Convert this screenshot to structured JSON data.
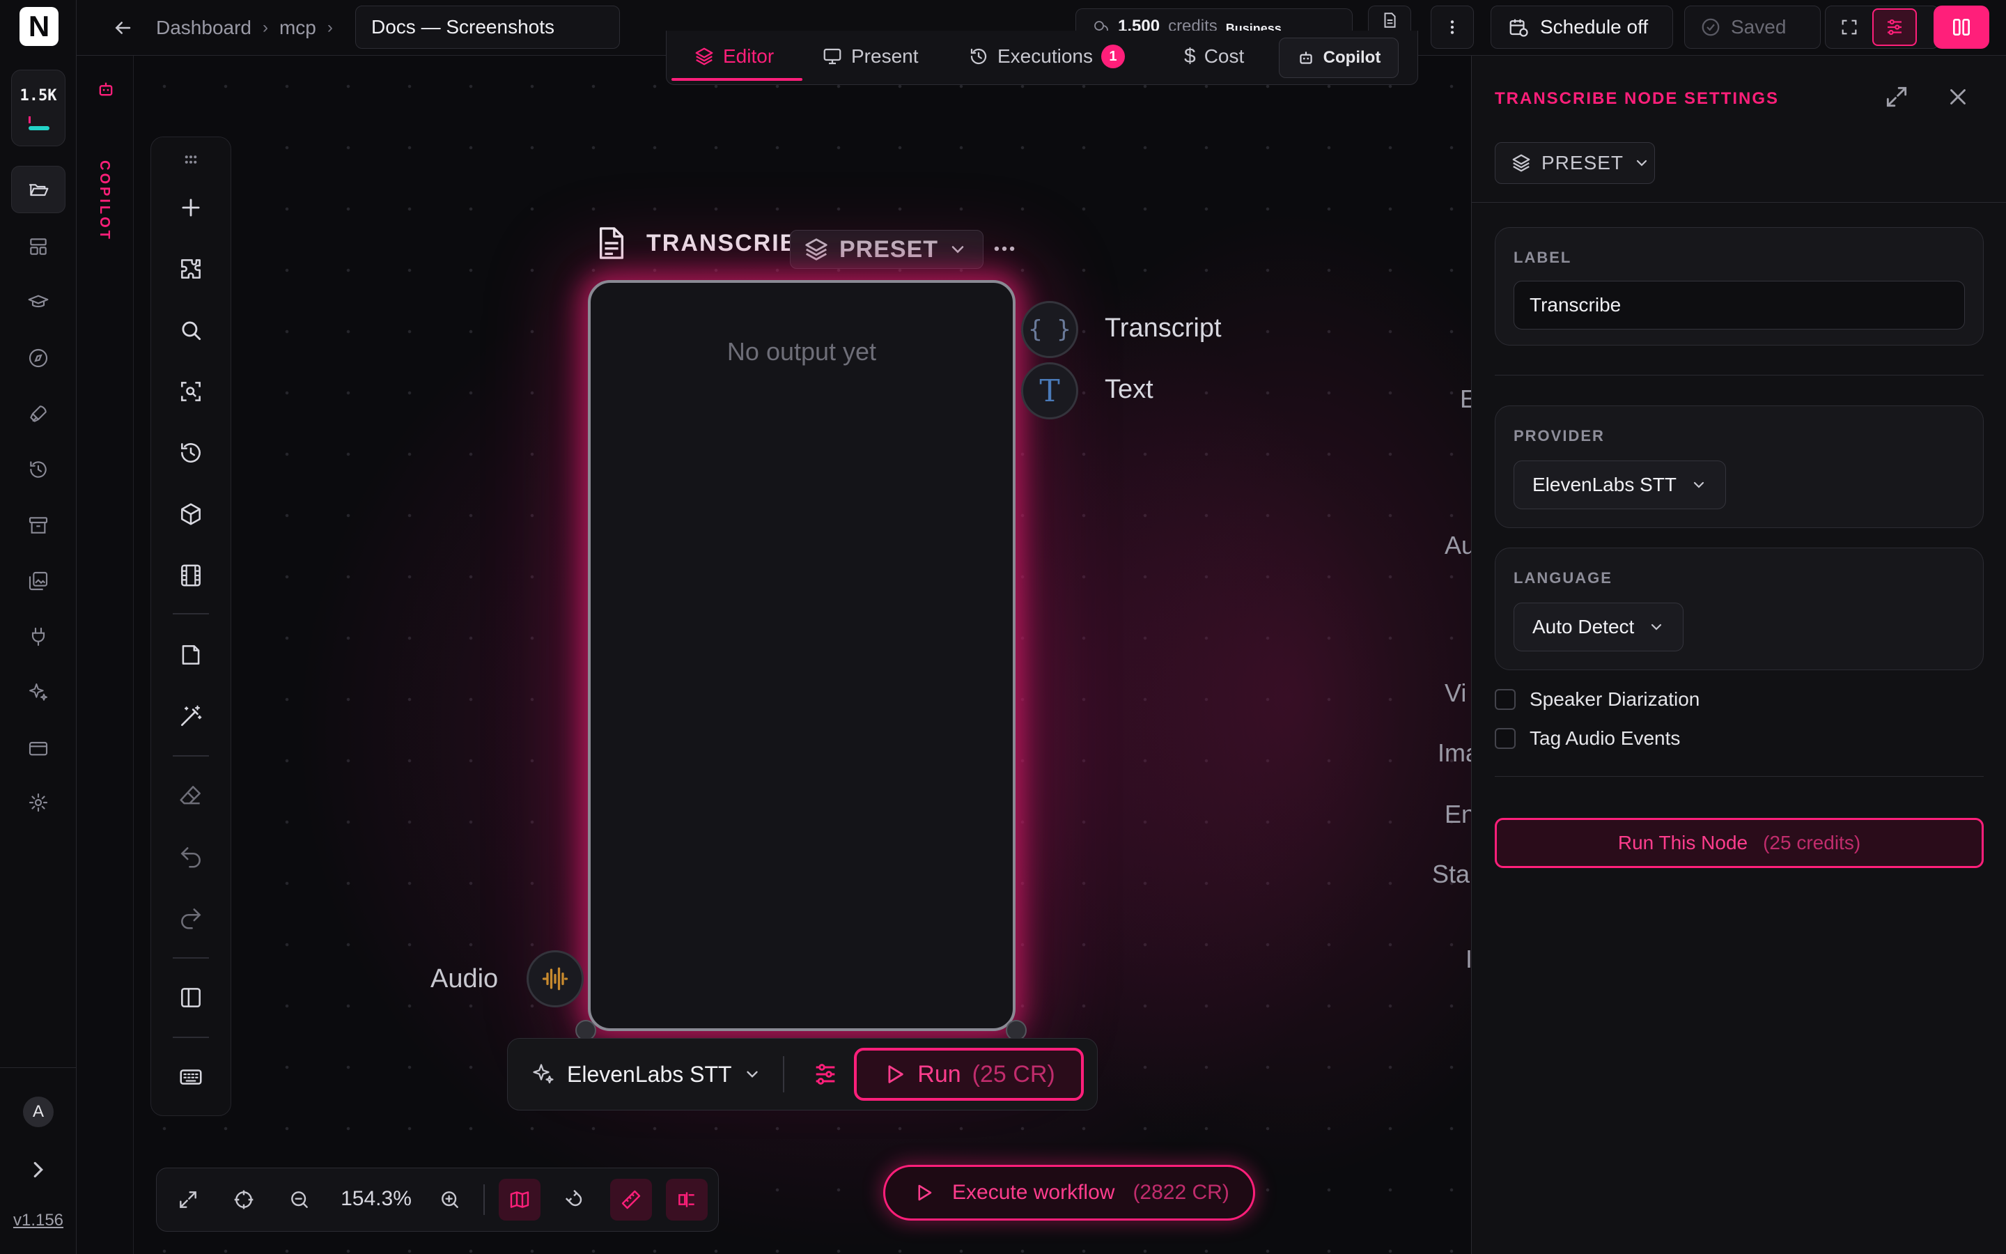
{
  "app": {
    "logo_letter": "N",
    "credits_short": "1.5K",
    "version": "v1.156",
    "avatar_initial": "A"
  },
  "topbar": {
    "breadcrumb": [
      "Dashboard",
      "mcp"
    ],
    "doc_title": "Docs — Screenshots",
    "credits_value": "1,500",
    "credits_label": "credits",
    "plan": "Business",
    "schedule_label": "Schedule off",
    "saved_label": "Saved"
  },
  "mode_tabs": {
    "editor": "Editor",
    "present": "Present",
    "executions": "Executions",
    "executions_badge": "1",
    "cost": "Cost",
    "copilot": "Copilot"
  },
  "copilot_strip": {
    "label": "COPILOT"
  },
  "node": {
    "title": "TRANSCRIBE",
    "preset_label": "PRESET",
    "empty_text": "No output yet",
    "outputs": [
      {
        "label": "Transcript",
        "icon": "braces-icon"
      },
      {
        "label": "Text",
        "icon": "text-t-icon"
      }
    ],
    "input_label": "Audio",
    "provider": "ElevenLabs STT",
    "run_label": "Run",
    "run_cost": "(25 CR)"
  },
  "edge_labels": [
    "E",
    "Au",
    "Vi",
    "Ima",
    "En",
    "Sta",
    "I"
  ],
  "zoom": {
    "level": "154.3%"
  },
  "execute": {
    "label": "Execute workflow",
    "cost": "(2822 CR)"
  },
  "settings_panel": {
    "title": "TRANSCRIBE NODE SETTINGS",
    "preset_label": "PRESET",
    "label_section": "LABEL",
    "label_value": "Transcribe",
    "provider_section": "PROVIDER",
    "provider_value": "ElevenLabs STT",
    "language_section": "LANGUAGE",
    "language_value": "Auto Detect",
    "speaker_diarization": "Speaker Diarization",
    "tag_audio_events": "Tag Audio Events",
    "run_label": "Run This Node",
    "run_cost": "(25 credits)"
  },
  "colors": {
    "accent": "#ff1f7a",
    "background": "#0a0a0c",
    "panel": "#111114",
    "teal": "#23d3c7"
  }
}
